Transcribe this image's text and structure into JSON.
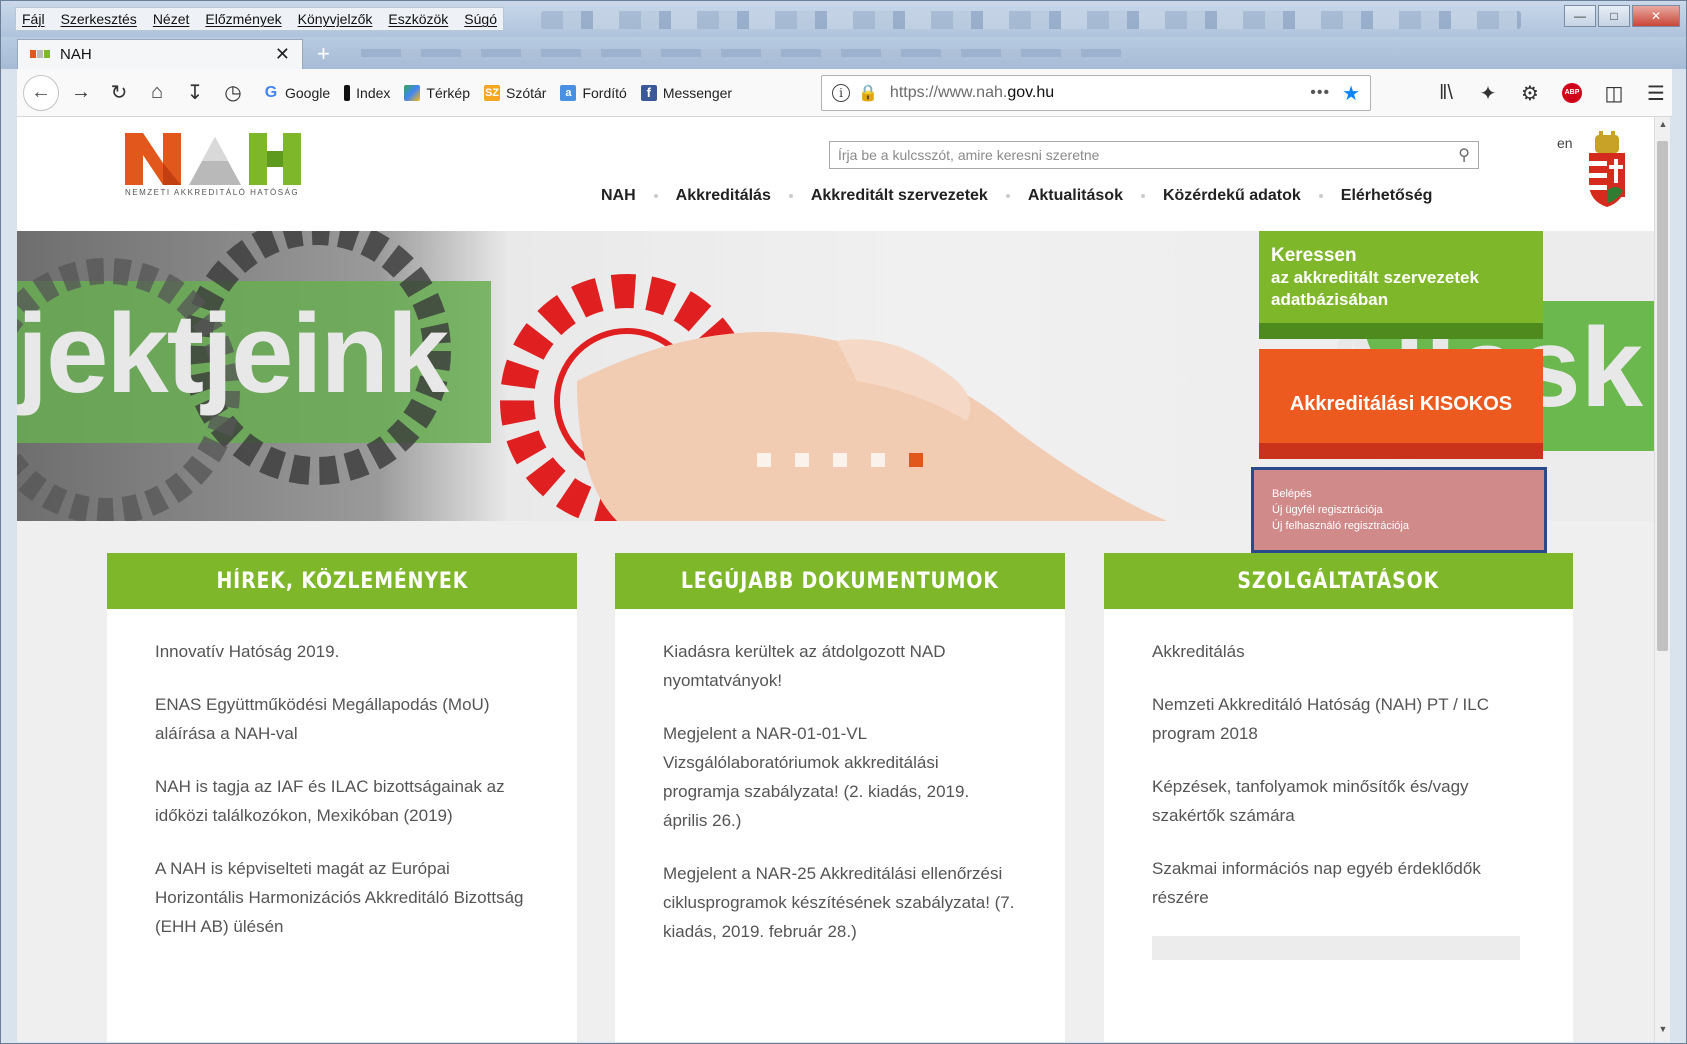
{
  "browser": {
    "menu": [
      "Fájl",
      "Szerkesztés",
      "Nézet",
      "Előzmények",
      "Könyvjelzők",
      "Eszközök",
      "Súgó"
    ],
    "tab_title": "NAH",
    "bookmarks": [
      {
        "label": "Google",
        "icon": "google-icon",
        "color": "#4285f4"
      },
      {
        "label": "Index",
        "icon": "index-icon",
        "color": "#111111"
      },
      {
        "label": "Térkép",
        "icon": "map-icon",
        "color": "#34a853"
      },
      {
        "label": "Szótár",
        "icon": "dictionary-icon",
        "color": "#f5a623"
      },
      {
        "label": "Fordító",
        "icon": "translate-icon",
        "color": "#4a90e2"
      },
      {
        "label": "Messenger",
        "icon": "facebook-icon",
        "color": "#3b5998"
      }
    ],
    "url_prefix": "https://www.nah.",
    "url_domain": "gov.hu",
    "url_more": "•••"
  },
  "site": {
    "logo_subtitle": "NEMZETI AKKREDITÁLÓ HATÓSÁG",
    "search_placeholder": "Írja be a kulcsszót, amire keresni szeretne",
    "lang": "en",
    "nav": [
      "NAH",
      "Akkreditálás",
      "Akkreditált szervezetek",
      "Aktualitások",
      "Közérdekű adatok",
      "Elérhetőség"
    ],
    "hero_text_left": "jektjeink",
    "hero_text_right": "Állask",
    "cta_green_line1": "Keressen",
    "cta_green_line2": "az akkreditált szervezetek",
    "cta_green_line3": "adatbázisában",
    "cta_orange": "Akkreditálási KISOKOS",
    "login_links": [
      "Belépés",
      "Új ügyfél regisztrációja",
      "Új felhasználó regisztrációja"
    ],
    "brand_green": "#7fb72b",
    "brand_orange": "#ec5a1f"
  },
  "columns": [
    {
      "title": "HÍREK, KÖZLEMÉNYEK",
      "items": [
        "Innovatív Hatóság 2019.",
        "ENAS Együttműködési Megállapodás (MoU) aláírása a NAH-val",
        "NAH is tagja az IAF és ILAC bizottságainak az időközi találkozókon, Mexikóban (2019)",
        "A NAH is képviselteti magát az Európai Horizontális Harmonizációs Akkreditáló Bizottság (EHH AB) ülésén"
      ]
    },
    {
      "title": "LEGÚJABB DOKUMENTUMOK",
      "items": [
        "Kiadásra kerültek az átdolgozott NAD nyomtatványok!",
        "Megjelent a NAR-01-01-VL Vizsgálólaboratóriumok akkreditálási programja szabályzata! (2. kiadás, 2019. április 26.)",
        "Megjelent a NAR-25 Akkreditálási ellenőrzési ciklusprogramok készítésének szabályzata! (7. kiadás, 2019. február 28.)"
      ]
    },
    {
      "title": "SZOLGÁLTATÁSOK",
      "items": [
        "Akkreditálás",
        "Nemzeti Akkreditáló Hatóság (NAH) PT / ILC program 2018",
        "Képzések, tanfolyamok minősítők és/vagy szakértők számára",
        "Szakmai információs nap egyéb érdeklődők részére"
      ]
    }
  ]
}
